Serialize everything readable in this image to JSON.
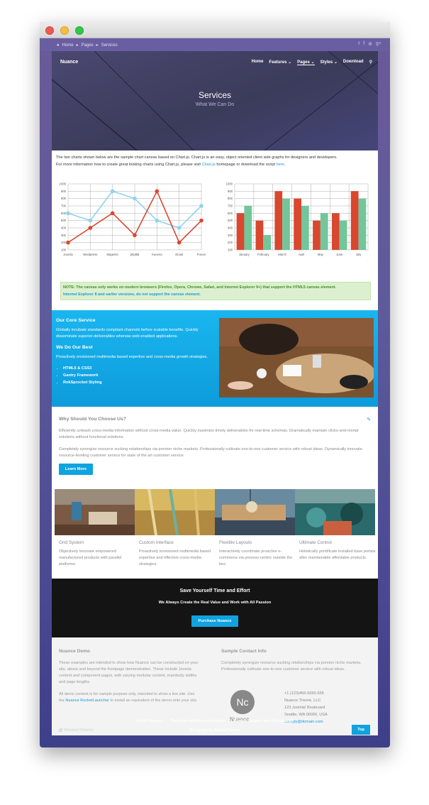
{
  "breadcrumb": {
    "items": [
      "Home",
      "Pages",
      "Services"
    ]
  },
  "social_icons": [
    "twitter-icon",
    "facebook-icon",
    "rss-icon",
    "google-plus-icon"
  ],
  "header": {
    "logo": "Nuance",
    "nav": [
      "Home",
      "Features",
      "Pages",
      "Styles",
      "Download"
    ],
    "active_nav": "Pages",
    "title": "Services",
    "subtitle": "What We Can Do"
  },
  "intro": {
    "line1": "The two charts shown below are the sample chart canvas based on Chart.js. Chart.js is an easy, object oriented client side graphs for designers and developers.",
    "line2_pre": "For more information how to create great looking charts using Chart.js, please visit ",
    "link1": "Chart.js",
    "line2_mid": " homepage or download the script ",
    "link2": "here",
    "line2_end": "."
  },
  "chart_data": [
    {
      "type": "line",
      "categories": [
        "Joomla",
        "Wordpress",
        "Magento",
        "phpBB",
        "Kunena",
        "Email",
        "Forum"
      ],
      "ylim": [
        100,
        1000
      ],
      "yticks": [
        100,
        200,
        300,
        400,
        500,
        600,
        700,
        800,
        900,
        1000
      ],
      "series": [
        {
          "values": [
            600,
            500,
            900,
            800,
            500,
            400,
            700
          ],
          "color": "#8fd3f0"
        },
        {
          "values": [
            200,
            400,
            600,
            300,
            900,
            200,
            500
          ],
          "color": "#d9472f"
        }
      ]
    },
    {
      "type": "bar",
      "categories": [
        "January",
        "February",
        "March",
        "April",
        "May",
        "June",
        "July"
      ],
      "ylim": [
        100,
        1000
      ],
      "yticks": [
        100,
        200,
        300,
        400,
        500,
        600,
        700,
        800,
        900,
        1000
      ],
      "series": [
        {
          "values": [
            600,
            500,
            900,
            800,
            500,
            600,
            900
          ],
          "color": "#d9472f"
        },
        {
          "values": [
            700,
            300,
            800,
            700,
            600,
            500,
            800
          ],
          "color": "#72c69a"
        }
      ]
    }
  ],
  "note": {
    "green": "NOTE: The canvas only works on modern browsers (Firefox, Opera, Chrome, Safari, and Internet Explorer 9+) that support the HTML5 canvas element.",
    "blue": "Internet Explorer 8 and earlier versions, do not support the canvas element."
  },
  "core": {
    "title": "Our Core Service",
    "text": "Globally incubate standards compliant channels before scalable benefits. Quickly disseminate superior deliverables whereas web-enabled applications.",
    "title2": "We Do Our Best",
    "text2": "Proactively envisioned multimedia based expertise and cross-media growth strategies.",
    "list": [
      "HTML5 & CSS3",
      "Gantry Framework",
      "RokSprocket Styling"
    ]
  },
  "why": {
    "title": "Why Should You Choose Us?",
    "p1": "Efficiently unleash cross-media information without cross-media value. Quickly maximize timely deliverables for real-time schemas. Dramatically maintain clicks-and-mortar solutions without functional solutions.",
    "p2": "Completely synergize resource sucking relationships via premier niche markets. Professionally cultivate one-to-one customer service with robust ideas. Dynamically innovate resource-leveling customer service for state of the art customer service.",
    "button": "Learn More"
  },
  "features": [
    {
      "title": "Grid System",
      "text": "Objectively innovate empowered manufactured products with parallel platforms."
    },
    {
      "title": "Custom Interface",
      "text": "Proactively envisioned multimedia based expertise and effective cross-media strategies."
    },
    {
      "title": "Flexible Layouts",
      "text": "Interactively coordinate proactive e-commerce via process-centric outside the box."
    },
    {
      "title": "Ultimate Control",
      "text": "Holistically pontificate installed base portals after maintainable affordable products."
    }
  ],
  "cta": {
    "title": "Save Yourself Time and Effort",
    "subtitle": "We Always Create the Real Value and Work with All Passion",
    "button": "Purchase Nuance"
  },
  "demo": {
    "title": "Nuance Demo",
    "p1": "These examples are intended to show how Nuance can be constructed on your site, above and beyond the frontpage demonstration. These include Joomla content and component pages, with varying modular content, mainbody widths and page lengths.",
    "p2_pre": "All demo content is for sample purpose only, intended to show a live site. Use the ",
    "p2_link": "Nuance RocketLauncher",
    "p2_post": " to install an equivalent of the demo onto your site."
  },
  "contact": {
    "title": "Sample Contact Info",
    "text": "Completely synergize resource sucking relationships via premier niche markets. Professionally cultivate one-to-one customer service with robust ideas.",
    "logo_mark": "Nc",
    "logo_text": "Nuance",
    "phone": "+1 (123)456-5555-555",
    "company": "Nuance Theme, LLC",
    "street": "123 Joomla! Boulevard",
    "city": "Seattle, WA 00000, USA",
    "email": "noreply@domain.com"
  },
  "footer": {
    "links": [
      "About Nuance",
      "Tutorials and Documentation",
      "Forum Support and Community"
    ],
    "brand": "RocketTheme",
    "designed": "Designed by RocketTheme",
    "top": "Top"
  }
}
